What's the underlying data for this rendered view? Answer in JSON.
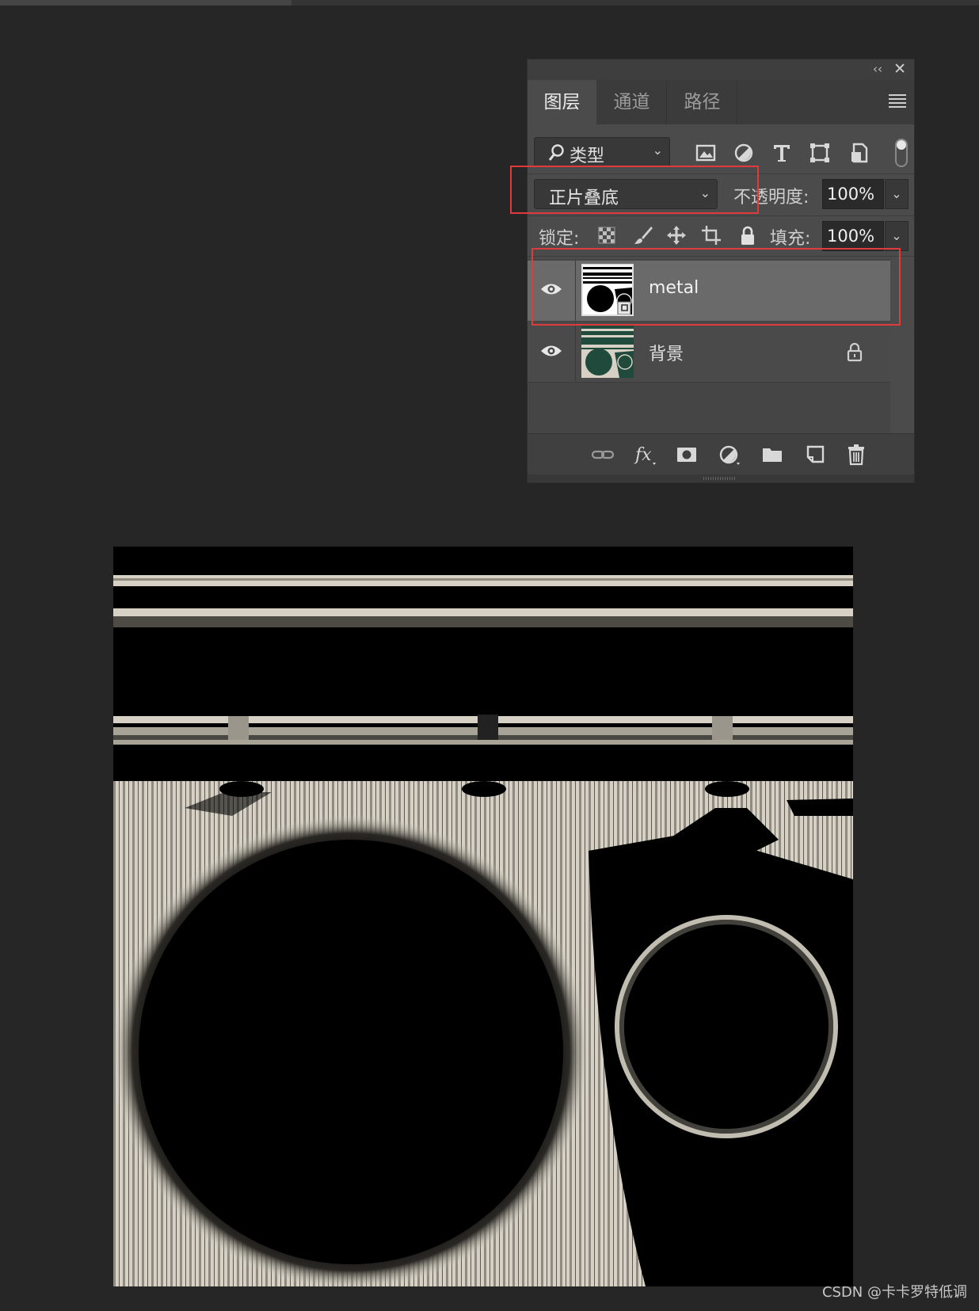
{
  "panel": {
    "tabs": [
      "图层",
      "通道",
      "路径"
    ],
    "active_tab": 0,
    "filter_label": "类型",
    "blend_mode": "正片叠底",
    "opacity_label": "不透明度:",
    "opacity_value": "100%",
    "lock_label": "锁定:",
    "fill_label": "填充:",
    "fill_value": "100%",
    "layers": [
      {
        "name": "metal",
        "selected": true,
        "visible": true
      },
      {
        "name": "背景",
        "selected": false,
        "visible": true,
        "locked": true
      }
    ],
    "filter_icons": [
      "image-filter-icon",
      "adjustment-filter-icon",
      "type-filter-icon",
      "shape-filter-icon",
      "smart-object-filter-icon"
    ],
    "lock_icons": [
      "lock-transparent-pixels-icon",
      "lock-image-pixels-icon",
      "lock-position-icon",
      "lock-artboard-icon",
      "lock-all-icon"
    ],
    "bottom_icons": [
      "link-layers-icon",
      "fx-icon",
      "add-mask-icon",
      "adjustment-layer-icon",
      "group-folder-icon",
      "new-layer-icon",
      "delete-trash-icon"
    ]
  },
  "colors": {
    "annotation": "#e03a3a",
    "background_layer_green": "#1f4a3c",
    "texture_cream": "#d6d1c4"
  },
  "watermark": "CSDN @卡卡罗特低调"
}
